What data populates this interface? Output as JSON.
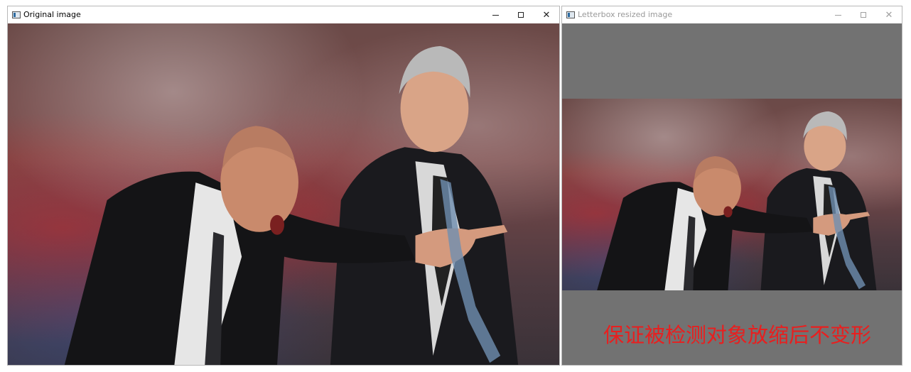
{
  "windows": {
    "original": {
      "title": "Original image",
      "controls": {
        "minimize": "─",
        "maximize": "□",
        "close": "✕"
      }
    },
    "letterbox": {
      "title": "Letterbox resized image",
      "controls": {
        "minimize": "─",
        "maximize": "□",
        "close": "✕"
      },
      "caption": "保证被检测对象放缩后不变形"
    }
  },
  "photo": {
    "description_icon": "two-coaches-photo"
  },
  "colors": {
    "letterbox_fill": "#727272",
    "caption_red": "#e81f1f"
  }
}
